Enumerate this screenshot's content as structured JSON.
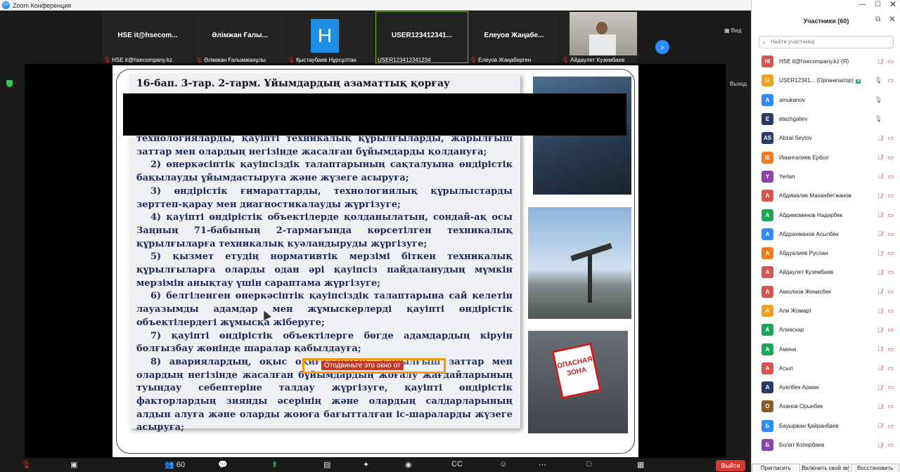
{
  "app": {
    "title": "Zoom Конференция"
  },
  "header": {
    "view_label": "Вид",
    "exit_label": "Выход"
  },
  "thumbnails": [
    {
      "name": "HSE it@hsecom...",
      "label": "HSE it@hsecompany.kz"
    },
    {
      "name": "Әлімжан Ғалы...",
      "label": "Әлімжан Ғалымжанұлы"
    },
    {
      "name": "H",
      "label": "Қыстаубаев Нұрсұлтан"
    },
    {
      "name": "USER123412341...",
      "label": "USER123412341234"
    },
    {
      "name": "Елеуов Жаңабе...",
      "label": "Елеуов Жаңаберген"
    },
    {
      "name": "",
      "label": "Айдаулет Кузембаев"
    }
  ],
  "slide": {
    "title": "16-бап. 3-тар. 2-тарм. Ұйымдардың азаматтық қорғау",
    "paragraphs": [
      "технологияларды, қауіпті техникалық құрылғыларды, жарылғыш заттар мен олардың негізінде жасалған бұйымдарды қолдануға;",
      "2) өнеркәсіптік қауіпсіздік талаптарының сақталуына өндірістік бақылауды ұйымдастыруға және жүзеге асыруға;",
      "3) өндірістік ғимараттарды, технологиялық құрылыстарды зерттеп-қарау мен диагностикалауды жүргізуге;",
      "4) қауіпті өндірістік объектілерде қолданылатын, сондай-ақ осы Заңның 71-бабының 2-тармағында көрсетілген техникалық құрылғыларға техникалық куәландыруды жүргізуге;",
      "5) қызмет етудің нормативтік мерзімі біткен техникалық құрылғыларға оларды одан әрі қауіпсіз пайдаланудың мүмкін мерзімін анықтау үшін сараптама жүргізуге;",
      "6) белгіленген өнеркәсіптік қауіпсіздік талаптарына сай келетін лауазымды адамдар мен жұмыскерлерді қауіпті өндірістік объектілердегі жұмысқа жіберуге;",
      "7) қауіпті өндірістік объектілерге бөгде адамдардың кіруін болғызбау жөнінде шаралар қабылдауға;",
      "8) авариялардың, оқыс оқиғалардың, жарылғыш заттар мен олардың негізінде жасалған бұйымдардың жоғалу жағдайларының туындау себептеріне талдау жүргізуге, қауіпті өндірістік факторлардың зиянды әсерінің және олардың салдарларының алдын алуға және оларды жоюға бағытталған іс-шараларды жүзеге асыруға;"
    ],
    "sign_text": "ОПАСНАЯ ЗОНА"
  },
  "remote_control": {
    "text": "Отодвиньте это окно от"
  },
  "toolbar": {
    "participants_count": "60",
    "leave_label": "Выйти"
  },
  "panel": {
    "title": "Участники (60)",
    "search_placeholder": "Найти участника",
    "participants": [
      {
        "initials": "HI",
        "name": "HSE it@hsecompany.kz (Я)",
        "color": "#d9534f",
        "mic": "off",
        "video": "off"
      },
      {
        "initials": "U",
        "name": "USER12341... (Организатор)",
        "color": "#f0a020",
        "mic": "on",
        "video": "off",
        "tag": "●"
      },
      {
        "initials": "A",
        "name": "amukanov",
        "color": "#2d8cff",
        "mic": "on",
        "video": ""
      },
      {
        "initials": "E",
        "name": "etazhgaliev",
        "color": "#2a3a66",
        "mic": "on",
        "video": ""
      },
      {
        "initials": "AS",
        "name": "Abzal Seytov",
        "color": "#2a3a66",
        "mic": "off",
        "video": "off"
      },
      {
        "initials": "IE",
        "name": "Имангалиев Ербол",
        "color": "#f07a20",
        "mic": "off",
        "video": "off"
      },
      {
        "initials": "Y",
        "name": "Yerlan",
        "color": "#8e44ad",
        "mic": "off",
        "video": "off"
      },
      {
        "initials": "А",
        "name": "Абдималик Маханбетжанов",
        "color": "#d9534f",
        "mic": "off",
        "video": "off"
      },
      {
        "initials": "А",
        "name": "Абдимоминов Надирбек",
        "color": "#1aa55a",
        "mic": "off",
        "video": "off"
      },
      {
        "initials": "А",
        "name": "Абдрахманов Асылбек",
        "color": "#2d8cff",
        "mic": "off",
        "video": "off"
      },
      {
        "initials": "А",
        "name": "Абдуалиев Руслан",
        "color": "#f07a20",
        "mic": "off",
        "video": "off"
      },
      {
        "initials": "А",
        "name": "Айдаулет Кузембаев",
        "color": "#d9534f",
        "mic": "off",
        "video": "off"
      },
      {
        "initials": "А",
        "name": "Акколнов Женисбек",
        "color": "#d9534f",
        "mic": "off",
        "video": "off"
      },
      {
        "initials": "А",
        "name": "Али Жомарт",
        "color": "#f0a020",
        "mic": "off",
        "video": "off"
      },
      {
        "initials": "А",
        "name": "Алиаскар",
        "color": "#1aa55a",
        "mic": "off",
        "video": "off"
      },
      {
        "initials": "А",
        "name": "Амина",
        "color": "#1aa55a",
        "mic": "off",
        "video": "off"
      },
      {
        "initials": "А",
        "name": "Асыл",
        "color": "#d9534f",
        "mic": "off",
        "video": "off"
      },
      {
        "initials": "А",
        "name": "Ауелбек Арман",
        "color": "#2a3a66",
        "mic": "off",
        "video": "off"
      },
      {
        "initials": "О",
        "name": "Аханов Орынбек",
        "color": "#8a5a2b",
        "mic": "off",
        "video": "off"
      },
      {
        "initials": "Б",
        "name": "Бауыржан Қайранбаев",
        "color": "#2d8cff",
        "mic": "off",
        "video": "off"
      },
      {
        "initials": "Б",
        "name": "Болат Копирбаев",
        "color": "#8e44ad",
        "mic": "off",
        "video": "off"
      }
    ],
    "footer": [
      "Пригласить",
      "Включить свой звук",
      "Восстановить"
    ]
  }
}
